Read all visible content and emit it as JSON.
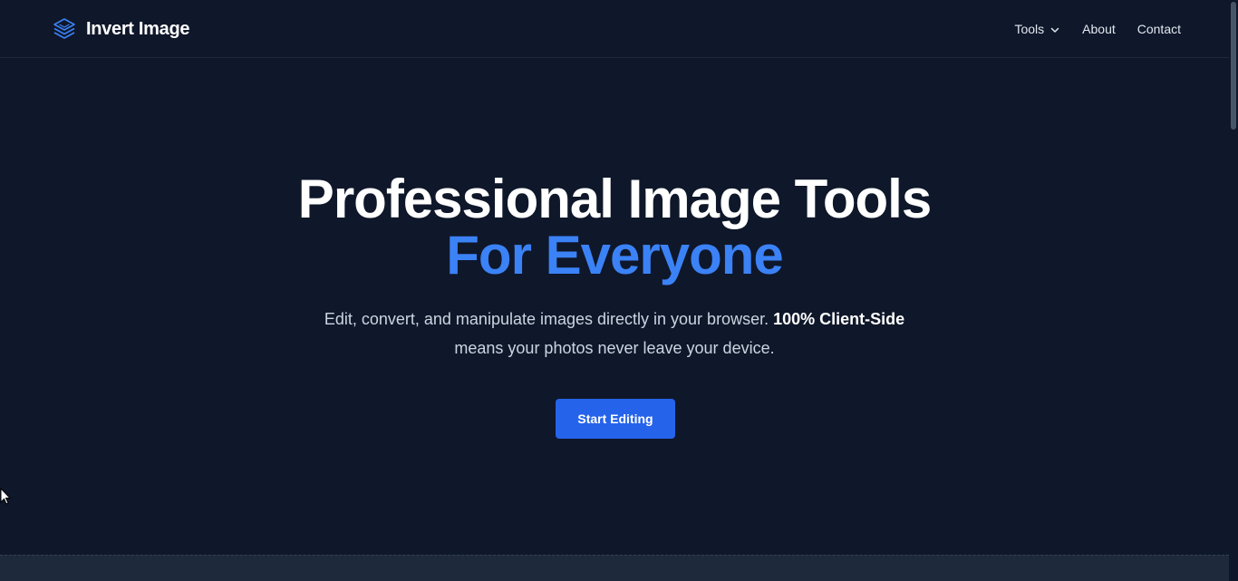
{
  "header": {
    "brand_name": "Invert Image",
    "brand_icon": "layers-icon",
    "nav": {
      "tools_label": "Tools",
      "about_label": "About",
      "contact_label": "Contact"
    }
  },
  "hero": {
    "title_line1": "Professional Image Tools",
    "title_line2": "For Everyone",
    "desc_part1": "Edit, convert, and manipulate images directly in your browser.",
    "desc_strong": "100% Client-Side",
    "desc_part2": "means your photos never leave your device.",
    "cta_label": "Start Editing"
  },
  "colors": {
    "background": "#0f172a",
    "accent": "#3b82f6",
    "button": "#2563eb",
    "text_muted": "#cbd5e1"
  }
}
